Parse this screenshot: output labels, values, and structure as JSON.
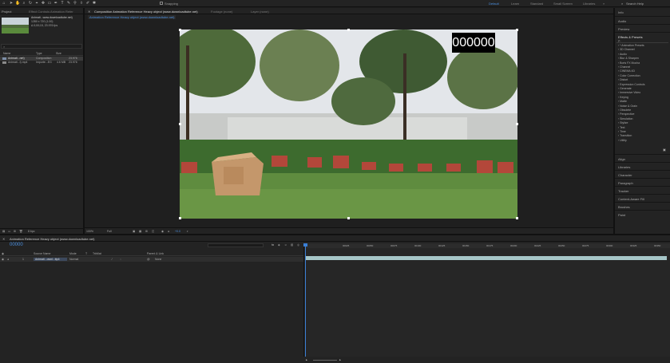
{
  "workspaces": [
    "Default",
    "Learn",
    "Standard",
    "Small Screen",
    "Libraries"
  ],
  "search_help": "Search Help",
  "snapping": "Snapping",
  "project_panel": {
    "tab_project": "Project",
    "tab_effect_controls": "Effect Controls Animation Refer",
    "item_name": "Animati...oad.mp4",
    "item_line1": "Animati...www.downloadtube.net)",
    "item_line2": "1280 x 720 (1.00)",
    "item_line3": "Δ 0;00;15, 23.976 fps",
    "columns": [
      "Name",
      "Type",
      "Size"
    ],
    "rows": [
      {
        "name": "Animati...net)",
        "type": "Composition",
        "size": "23.976"
      },
      {
        "name": "Animati...t).mp4",
        "type": "Importe...EG",
        "size": "4.6 MB",
        "fps": "23.976"
      }
    ],
    "bpc": "8 bpc"
  },
  "comp_panel": {
    "tab_composition": "Composition Animation Reference Heavy object (www.downloadtube.net)",
    "tab_footage": "Footage (none)",
    "tab_layer": "Layer (none)",
    "subtab": "Animation Reference Heavy object (www.downloadtube.net)",
    "timecode_overlay": "000000",
    "zoom": "100%",
    "resolution": "Full",
    "exposure": "+0.0"
  },
  "right_panel": {
    "info": "Info",
    "audio": "Audio",
    "preview": "Preview",
    "effects_presets": "Effects & Presets",
    "search_placeholder": "ρ-",
    "effects": [
      "* Animation Presets",
      "3D Channel",
      "Audio",
      "Blur & Sharpen",
      "Boris FX Mocha",
      "Channel",
      "CINEMA 4D",
      "Color Correction",
      "Distort",
      "Expression Controls",
      "Generate",
      "Immersive Video",
      "Keying",
      "Matte",
      "Noise & Grain",
      "Obsolete",
      "Perspective",
      "Simulation",
      "Stylize",
      "Text",
      "Time",
      "Transition",
      "Utility"
    ],
    "sections": [
      "Align",
      "Libraries",
      "Character",
      "Paragraph",
      "Tracker",
      "Content-Aware Fill",
      "Brushes",
      "Paint"
    ]
  },
  "timeline": {
    "tab": "Animation Reference Heavy object (www.downloadtube.net)",
    "timecode": "00000",
    "columns": [
      "Source Name",
      "Mode",
      "T",
      "TrkMat",
      "Parent & Link"
    ],
    "layer": {
      "num": "1",
      "name": "Animati...ownl...ttp4",
      "mode": "Normal",
      "parent": "None"
    },
    "ruler": [
      "00025",
      "00050",
      "00075",
      "00100",
      "00125",
      "00150",
      "00175",
      "00200",
      "00225",
      "00250",
      "00275",
      "00300",
      "00325",
      "00350"
    ]
  }
}
